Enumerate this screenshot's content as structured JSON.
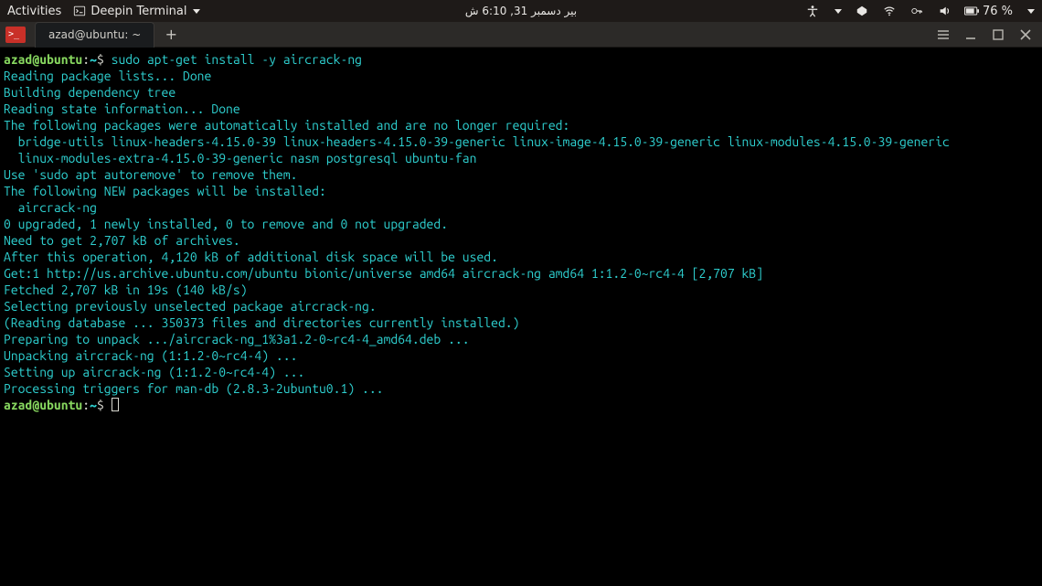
{
  "topbar": {
    "activities": "Activities",
    "app_menu": "Deepin Terminal",
    "clock": "بير دسمبر 31, 6:10 ش",
    "battery_pct": "76 %"
  },
  "window": {
    "tab_title": "azad@ubuntu: ~",
    "new_tab": "+"
  },
  "prompt": {
    "user_host": "azad@ubuntu",
    "sep": ":",
    "path": "~",
    "sigil": "$"
  },
  "cmd": "sudo apt-get install -y aircrack-ng",
  "out": [
    "Reading package lists... Done",
    "Building dependency tree",
    "Reading state information... Done",
    "The following packages were automatically installed and are no longer required:",
    "  bridge-utils linux-headers-4.15.0-39 linux-headers-4.15.0-39-generic linux-image-4.15.0-39-generic linux-modules-4.15.0-39-generic",
    "  linux-modules-extra-4.15.0-39-generic nasm postgresql ubuntu-fan",
    "Use 'sudo apt autoremove' to remove them.",
    "The following NEW packages will be installed:",
    "  aircrack-ng",
    "0 upgraded, 1 newly installed, 0 to remove and 0 not upgraded.",
    "Need to get 2,707 kB of archives.",
    "After this operation, 4,120 kB of additional disk space will be used.",
    "Get:1 http://us.archive.ubuntu.com/ubuntu bionic/universe amd64 aircrack-ng amd64 1:1.2-0~rc4-4 [2,707 kB]",
    "Fetched 2,707 kB in 19s (140 kB/s)",
    "Selecting previously unselected package aircrack-ng.",
    "(Reading database ... 350373 files and directories currently installed.)",
    "Preparing to unpack .../aircrack-ng_1%3a1.2-0~rc4-4_amd64.deb ...",
    "Unpacking aircrack-ng (1:1.2-0~rc4-4) ...",
    "Setting up aircrack-ng (1:1.2-0~rc4-4) ...",
    "Processing triggers for man-db (2.8.3-2ubuntu0.1) ..."
  ]
}
